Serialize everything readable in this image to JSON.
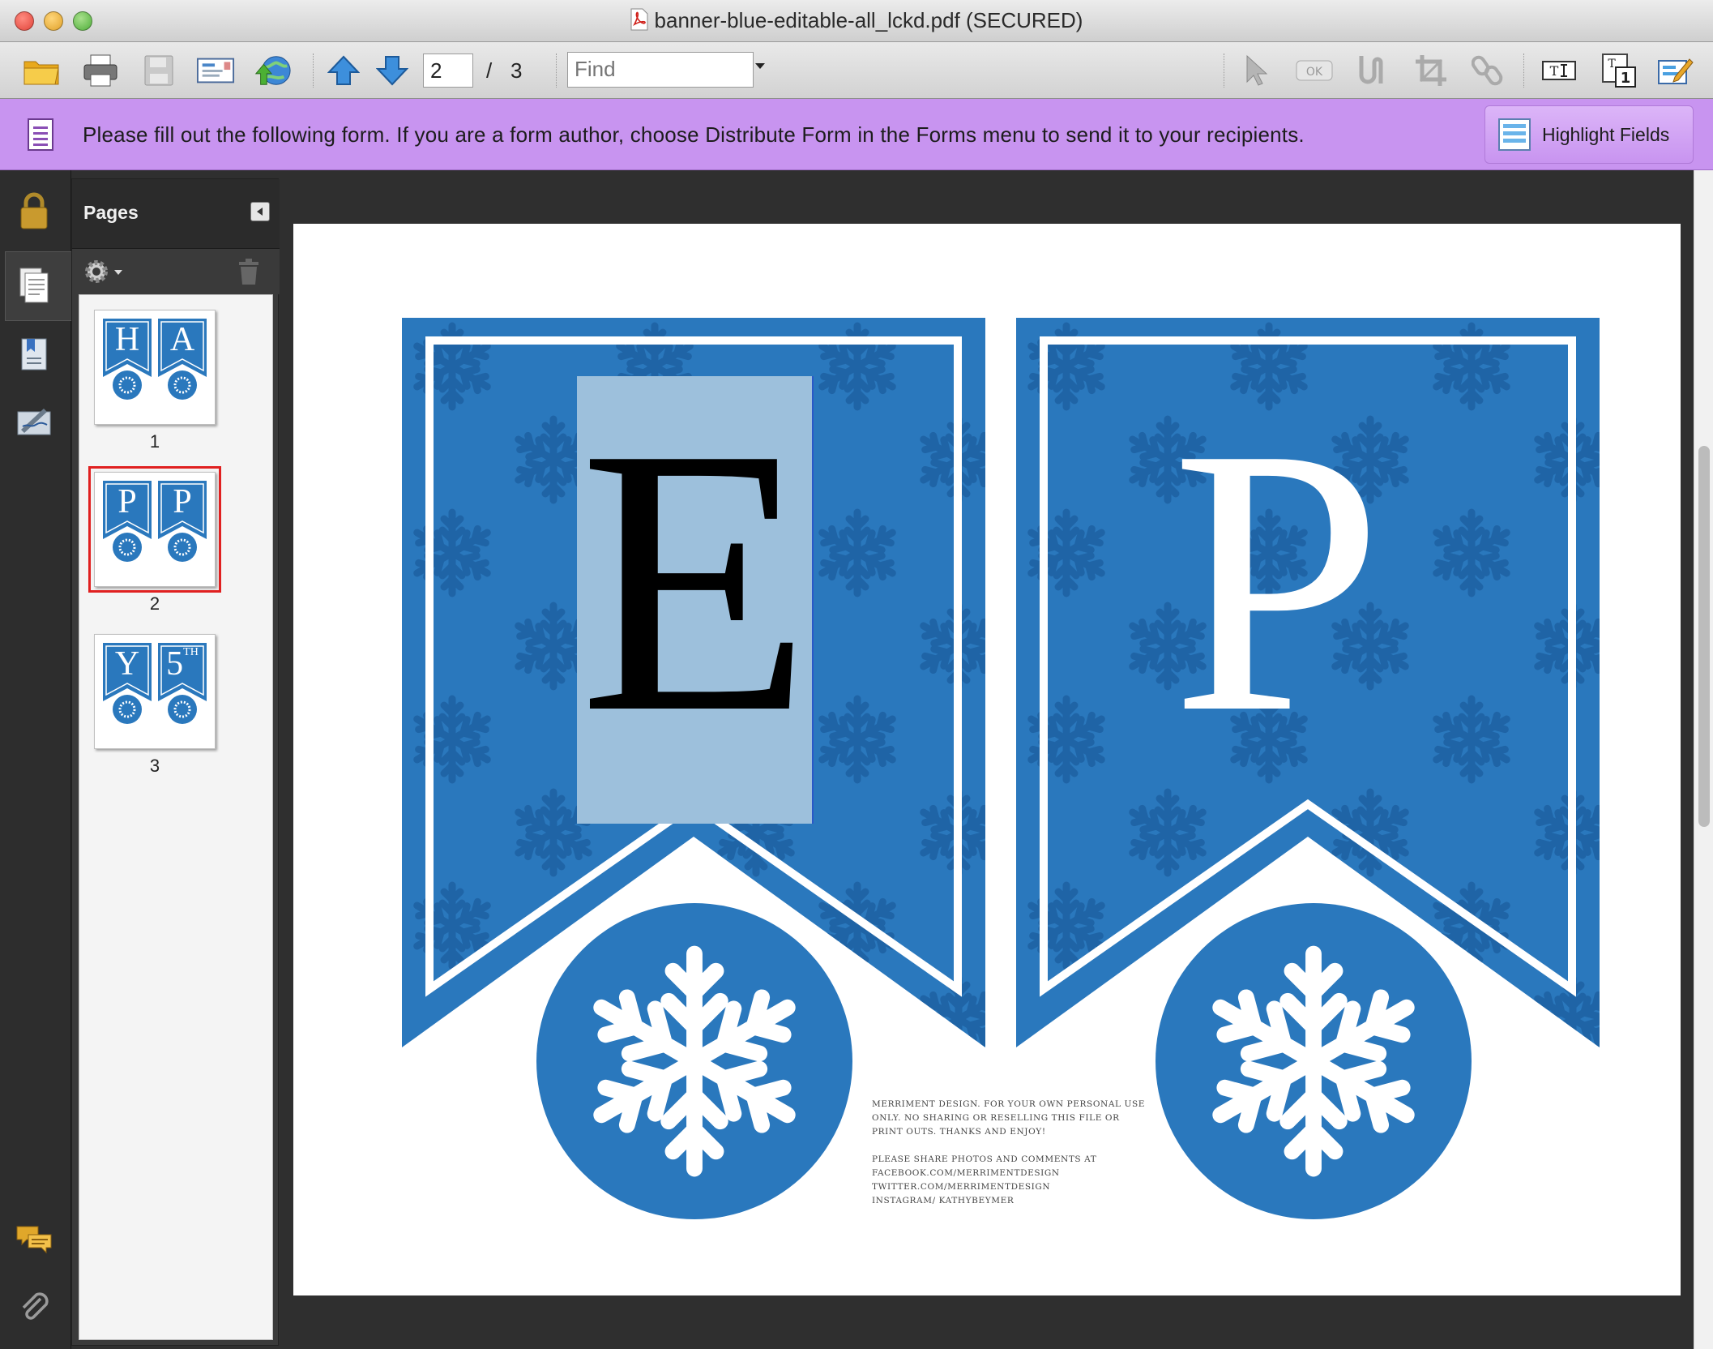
{
  "window": {
    "title": "banner-blue-editable-all_lckd.pdf (SECURED)"
  },
  "toolbar": {
    "current_page": "2",
    "page_separator": "/",
    "page_total": "3",
    "find_placeholder": "Find"
  },
  "form_bar": {
    "message": "Please fill out the following form. If you are a form author, choose Distribute Form in the Forms menu to send it to your recipients.",
    "highlight_label": "Highlight Fields"
  },
  "pages_panel": {
    "title": "Pages",
    "thumbnails": [
      {
        "number": "1",
        "letters": [
          "H",
          "A"
        ],
        "selected": false
      },
      {
        "number": "2",
        "letters": [
          "P",
          "P"
        ],
        "selected": true
      },
      {
        "number": "3",
        "letters": [
          "Y",
          "5"
        ],
        "superscript": "TH",
        "selected": false
      }
    ]
  },
  "document": {
    "left_letter": "E",
    "right_letter": "P",
    "credits_para1": "Merriment Design. For your own personal use only. No sharing or reselling this file or print outs. Thanks and enjoy!",
    "credits_line1": "Please share photos and comments at",
    "credits_line2": "facebook.com/merrimentdesign",
    "credits_line3": "twitter.com/merrimentdesign",
    "credits_line4": "instagram/ kathybeymer"
  },
  "colors": {
    "banner_blue": "#2a78bd",
    "field_highlight": "#9dc0dc",
    "form_bar": "#c894f0",
    "selection": "#e02020"
  }
}
